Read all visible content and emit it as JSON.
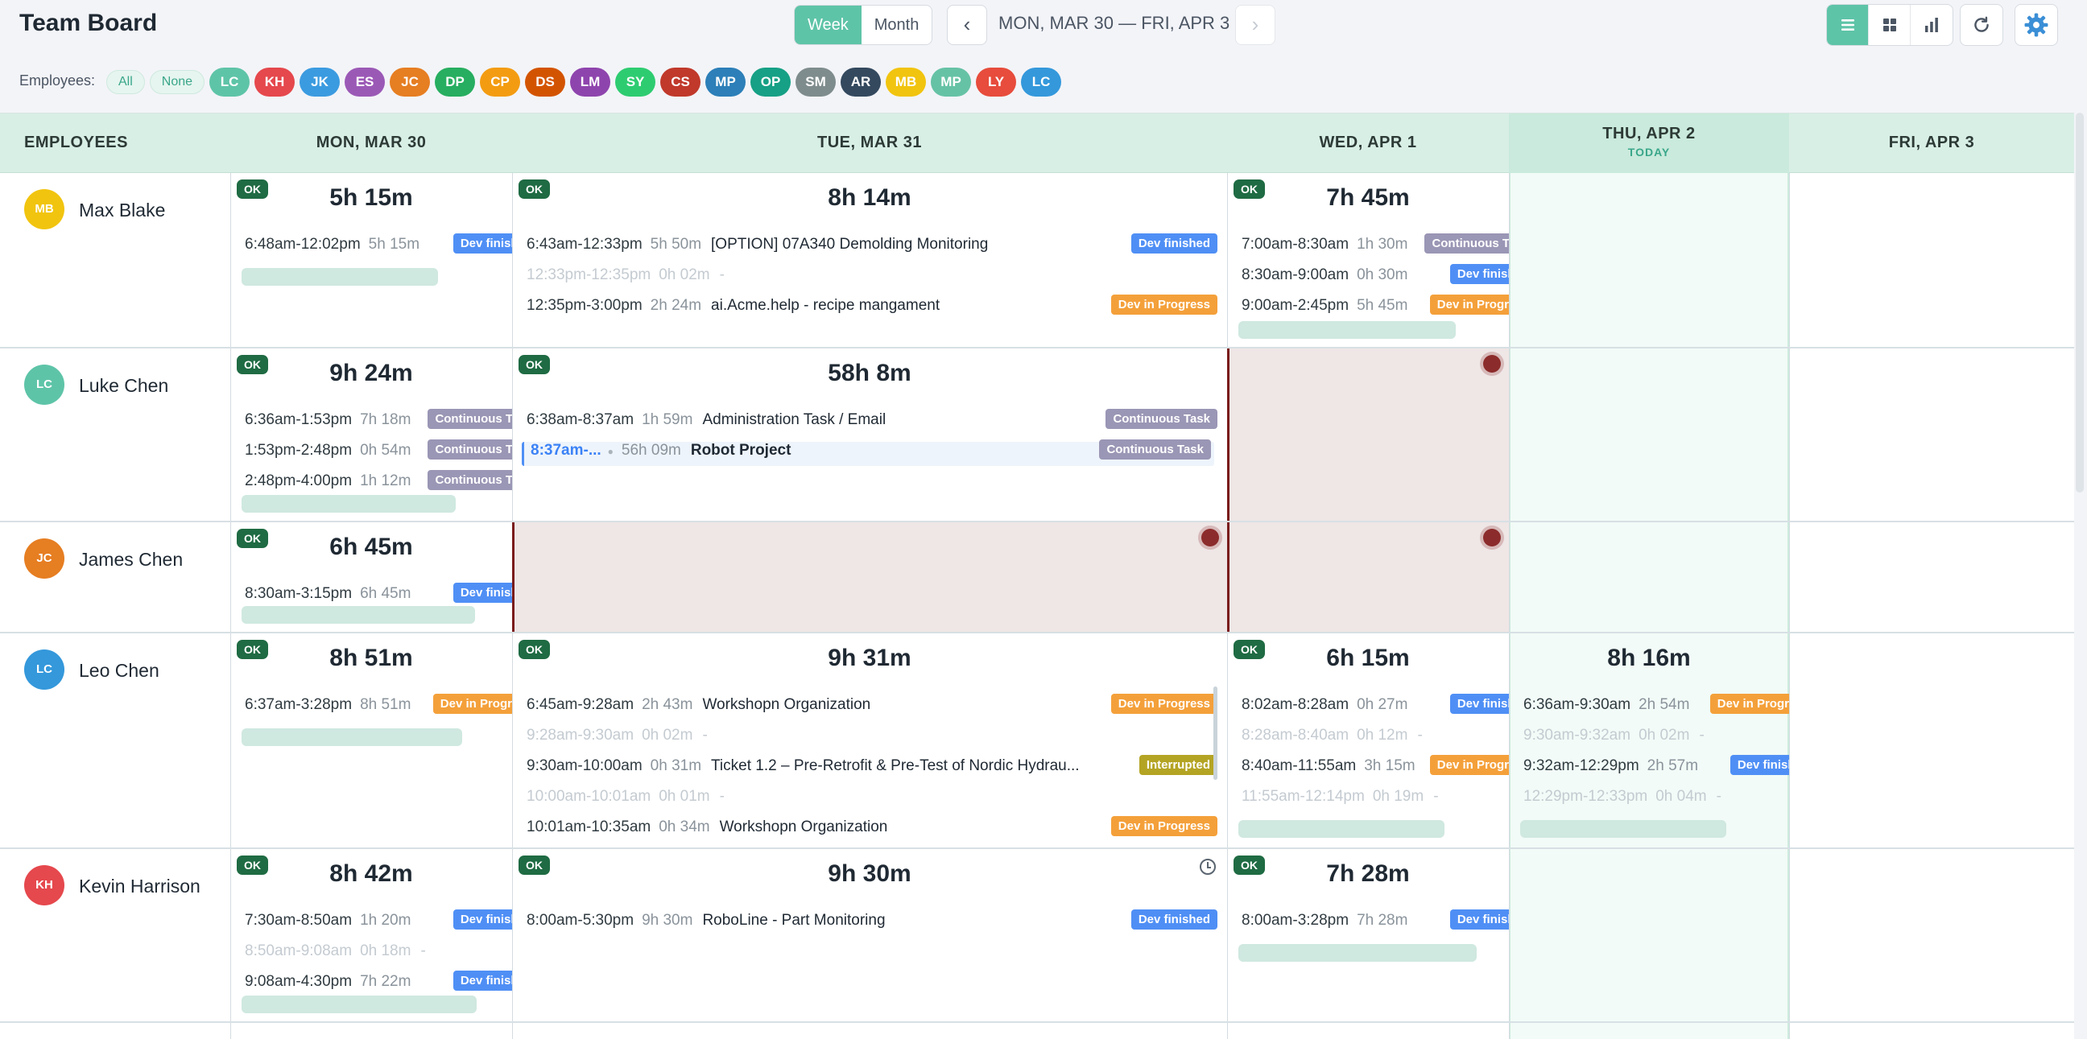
{
  "app": {
    "title": "Team Board"
  },
  "toolbar": {
    "view_week": "Week",
    "view_month": "Month",
    "prev": "‹",
    "next": "›",
    "date_range": "MON, MAR 30 — FRI, APR 3"
  },
  "filter": {
    "label": "Employees:",
    "all": "All",
    "none": "None",
    "chips": [
      {
        "initials": "LC",
        "color": "#5ec4a8"
      },
      {
        "initials": "KH",
        "color": "#e5484d"
      },
      {
        "initials": "JK",
        "color": "#3b9be0"
      },
      {
        "initials": "ES",
        "color": "#9b59b6"
      },
      {
        "initials": "JC",
        "color": "#e67e22"
      },
      {
        "initials": "DP",
        "color": "#27ae60"
      },
      {
        "initials": "CP",
        "color": "#f39c12"
      },
      {
        "initials": "DS",
        "color": "#d35400"
      },
      {
        "initials": "LM",
        "color": "#8e44ad"
      },
      {
        "initials": "SY",
        "color": "#2ecc71"
      },
      {
        "initials": "CS",
        "color": "#c0392b"
      },
      {
        "initials": "MP",
        "color": "#2c7fb8"
      },
      {
        "initials": "OP",
        "color": "#16a085"
      },
      {
        "initials": "SM",
        "color": "#7f8c8d"
      },
      {
        "initials": "AR",
        "color": "#34495e"
      },
      {
        "initials": "MB",
        "color": "#f1c40f"
      },
      {
        "initials": "MP",
        "color": "#66c2a5"
      },
      {
        "initials": "LY",
        "color": "#e74c3c"
      },
      {
        "initials": "LC",
        "color": "#3498db"
      }
    ]
  },
  "columns": {
    "employees": "EMPLOYEES",
    "mon": "MON, MAR 30",
    "tue": "TUE, MAR 31",
    "wed": "WED, APR 1",
    "thu": "THU, APR 2",
    "today": "TODAY",
    "fri": "FRI, APR 3"
  },
  "ok": "OK",
  "employees": [
    {
      "name": "Max Blake",
      "initials": "MB",
      "color": "#f1c40f",
      "mon": {
        "total": "5h 15m",
        "entries": [
          {
            "time": "6:48am-12:02pm",
            "dur": "5h 15m",
            "task": "",
            "badge": "Dev finished",
            "bcolor": "b-blue"
          }
        ]
      },
      "tue": {
        "total": "8h 14m",
        "entries": [
          {
            "time": "6:43am-12:33pm",
            "dur": "5h 50m",
            "task": "[OPTION] 07A340 Demolding Monitoring",
            "badge": "Dev finished",
            "bcolor": "b-blue"
          },
          {
            "time": "12:33pm-12:35pm",
            "dur": "0h 02m",
            "task": "-",
            "badge": "",
            "gap": true
          },
          {
            "time": "12:35pm-3:00pm",
            "dur": "2h 24m",
            "task": "ai.Acme.help - recipe mangament",
            "badge": "Dev in Progress",
            "bcolor": "b-orange"
          }
        ]
      },
      "wed": {
        "total": "7h 45m",
        "entries": [
          {
            "time": "7:00am-8:30am",
            "dur": "1h 30m",
            "task": "",
            "badge": "Continuous Task",
            "bcolor": "b-gray"
          },
          {
            "time": "8:30am-9:00am",
            "dur": "0h 30m",
            "task": "",
            "badge": "Dev finished",
            "bcolor": "b-blue"
          },
          {
            "time": "9:00am-2:45pm",
            "dur": "5h 45m",
            "task": "",
            "badge": "Dev in Progress",
            "bcolor": "b-orange"
          }
        ]
      }
    },
    {
      "name": "Luke Chen",
      "initials": "LC",
      "color": "#5ec4a8",
      "mon": {
        "total": "9h 24m",
        "entries": [
          {
            "time": "6:36am-1:53pm",
            "dur": "7h 18m",
            "task": "",
            "badge": "Continuous Task",
            "bcolor": "b-gray"
          },
          {
            "time": "1:53pm-2:48pm",
            "dur": "0h 54m",
            "task": "",
            "badge": "Continuous Task",
            "bcolor": "b-gray"
          },
          {
            "time": "2:48pm-4:00pm",
            "dur": "1h 12m",
            "task": "",
            "badge": "Continuous Task",
            "bcolor": "b-gray"
          }
        ]
      },
      "tue": {
        "total": "58h 8m",
        "entries": [
          {
            "time": "6:38am-8:37am",
            "dur": "1h 59m",
            "task": "Administration Task / Email",
            "badge": "Continuous Task",
            "bcolor": "b-gray"
          },
          {
            "time": "8:37am-...",
            "dur": "56h 09m",
            "task": "Robot Project",
            "badge": "Continuous Task",
            "bcolor": "b-gray",
            "selected": true
          }
        ]
      }
    },
    {
      "name": "James Chen",
      "initials": "JC",
      "color": "#e67e22",
      "mon": {
        "total": "6h 45m",
        "entries": [
          {
            "time": "8:30am-3:15pm",
            "dur": "6h 45m",
            "task": "",
            "badge": "Dev finished",
            "bcolor": "b-blue"
          }
        ]
      }
    },
    {
      "name": "Leo Chen",
      "initials": "LC",
      "color": "#3498db",
      "mon": {
        "total": "8h 51m",
        "entries": [
          {
            "time": "6:37am-3:28pm",
            "dur": "8h 51m",
            "task": "",
            "badge": "Dev in Progress",
            "bcolor": "b-orange"
          }
        ]
      },
      "tue": {
        "total": "9h 31m",
        "entries": [
          {
            "time": "6:45am-9:28am",
            "dur": "2h 43m",
            "task": "Workshopn Organization",
            "badge": "Dev in Progress",
            "bcolor": "b-orange"
          },
          {
            "time": "9:28am-9:30am",
            "dur": "0h 02m",
            "task": "-",
            "badge": "",
            "gap": true
          },
          {
            "time": "9:30am-10:00am",
            "dur": "0h 31m",
            "task": "Ticket 1.2 – Pre-Retrofit & Pre-Test of Nordic Hydrau...",
            "badge": "Interrupted",
            "bcolor": "b-olive"
          },
          {
            "time": "10:00am-10:01am",
            "dur": "0h 01m",
            "task": "-",
            "badge": "",
            "gap": true
          },
          {
            "time": "10:01am-10:35am",
            "dur": "0h 34m",
            "task": "Workshopn Organization",
            "badge": "Dev in Progress",
            "bcolor": "b-orange"
          }
        ]
      },
      "wed": {
        "total": "6h 15m",
        "entries": [
          {
            "time": "8:02am-8:28am",
            "dur": "0h 27m",
            "task": "",
            "badge": "Dev finished",
            "bcolor": "b-blue"
          },
          {
            "time": "8:28am-8:40am",
            "dur": "0h 12m",
            "task": "-",
            "badge": "",
            "gap": true
          },
          {
            "time": "8:40am-11:55am",
            "dur": "3h 15m",
            "task": "",
            "badge": "Dev in Progress",
            "bcolor": "b-orange"
          },
          {
            "time": "11:55am-12:14pm",
            "dur": "0h 19m",
            "task": "-",
            "badge": "",
            "gap": true
          }
        ]
      },
      "thu": {
        "total": "8h 16m",
        "entries": [
          {
            "time": "6:36am-9:30am",
            "dur": "2h 54m",
            "task": "",
            "badge": "Dev in Progress",
            "bcolor": "b-orange"
          },
          {
            "time": "9:30am-9:32am",
            "dur": "0h 02m",
            "task": "-",
            "badge": "",
            "gap": true
          },
          {
            "time": "9:32am-12:29pm",
            "dur": "2h 57m",
            "task": "",
            "badge": "Dev finished",
            "bcolor": "b-blue"
          },
          {
            "time": "12:29pm-12:33pm",
            "dur": "0h 04m",
            "task": "-",
            "badge": "",
            "gap": true
          }
        ]
      }
    },
    {
      "name": "Kevin Harrison",
      "initials": "KH",
      "color": "#e5484d",
      "mon": {
        "total": "8h 42m",
        "entries": [
          {
            "time": "7:30am-8:50am",
            "dur": "1h 20m",
            "task": "",
            "badge": "Dev finished",
            "bcolor": "b-blue"
          },
          {
            "time": "8:50am-9:08am",
            "dur": "0h 18m",
            "task": "-",
            "badge": "",
            "gap": true
          },
          {
            "time": "9:08am-4:30pm",
            "dur": "7h 22m",
            "task": "",
            "badge": "Dev finished",
            "bcolor": "b-blue"
          }
        ]
      },
      "tue": {
        "total": "9h 30m",
        "entries": [
          {
            "time": "8:00am-5:30pm",
            "dur": "9h 30m",
            "task": "RoboLine - Part Monitoring",
            "badge": "Dev finished",
            "bcolor": "b-blue"
          }
        ]
      },
      "wed": {
        "total": "7h 28m",
        "entries": [
          {
            "time": "8:00am-3:28pm",
            "dur": "7h 28m",
            "task": "",
            "badge": "Dev finished",
            "bcolor": "b-blue"
          }
        ]
      }
    }
  ]
}
